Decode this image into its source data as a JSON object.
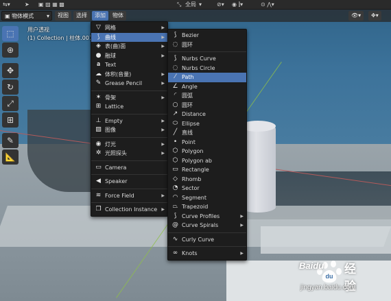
{
  "topbar": {
    "global_label": "全局"
  },
  "header": {
    "mode": "物体模式",
    "menus": [
      "视图",
      "选择",
      "添加",
      "物体"
    ]
  },
  "viewport_info": {
    "line1": "用户透视",
    "line2": "(1) Collection | 柱体.001"
  },
  "add_menu": {
    "items": [
      {
        "label": "网格",
        "icon": "mesh-icon",
        "submenu": true
      },
      {
        "label": "曲线",
        "icon": "curve-icon",
        "submenu": true,
        "highlight": true
      },
      {
        "label": "表(曲)面",
        "icon": "surface-icon",
        "submenu": true
      },
      {
        "label": "融球",
        "icon": "metaball-icon",
        "submenu": true
      },
      {
        "label": "Text",
        "icon": "text-icon",
        "submenu": false
      },
      {
        "label": "体积(音量)",
        "icon": "volume-icon",
        "submenu": true
      },
      {
        "label": "Grease Pencil",
        "icon": "grease-pencil-icon",
        "submenu": true
      },
      {
        "sep": true
      },
      {
        "label": "骨架",
        "icon": "armature-icon",
        "submenu": true
      },
      {
        "label": "Lattice",
        "icon": "lattice-icon",
        "submenu": false
      },
      {
        "sep": true
      },
      {
        "label": "Empty",
        "icon": "empty-icon",
        "submenu": true
      },
      {
        "label": "图像",
        "icon": "image-icon",
        "submenu": true
      },
      {
        "sep": true
      },
      {
        "label": "灯光",
        "icon": "light-icon",
        "submenu": true
      },
      {
        "label": "光照探头",
        "icon": "light-probe-icon",
        "submenu": true
      },
      {
        "sep": true
      },
      {
        "label": "Camera",
        "icon": "camera-icon",
        "submenu": false
      },
      {
        "sep": true
      },
      {
        "label": "Speaker",
        "icon": "speaker-icon",
        "submenu": false
      },
      {
        "sep": true
      },
      {
        "label": "Force Field",
        "icon": "force-field-icon",
        "submenu": true
      },
      {
        "sep": true
      },
      {
        "label": "Collection Instance",
        "icon": "collection-instance-icon",
        "submenu": true
      }
    ]
  },
  "curve_menu": {
    "items": [
      {
        "label": "Bezier",
        "icon": "bezier-icon"
      },
      {
        "label": "圆环",
        "icon": "circle-curve-icon"
      },
      {
        "sep": true
      },
      {
        "label": "Nurbs Curve",
        "icon": "nurbs-curve-icon"
      },
      {
        "label": "Nurbs Circle",
        "icon": "nurbs-circle-icon"
      },
      {
        "label": "Path",
        "icon": "path-icon",
        "highlight": true
      },
      {
        "label": "Angle",
        "icon": "angle-icon"
      },
      {
        "label": "圆弧",
        "icon": "arc-icon"
      },
      {
        "label": "圆环",
        "icon": "circle-icon"
      },
      {
        "label": "Distance",
        "icon": "distance-icon"
      },
      {
        "label": "Ellipse",
        "icon": "ellipse-icon"
      },
      {
        "label": "直线",
        "icon": "line-icon"
      },
      {
        "label": "Point",
        "icon": "point-icon"
      },
      {
        "label": "Polygon",
        "icon": "polygon-icon"
      },
      {
        "label": "Polygon ab",
        "icon": "polygon-ab-icon"
      },
      {
        "label": "Rectangle",
        "icon": "rectangle-icon"
      },
      {
        "label": "Rhomb",
        "icon": "rhomb-icon"
      },
      {
        "label": "Sector",
        "icon": "sector-icon"
      },
      {
        "label": "Segment",
        "icon": "segment-icon"
      },
      {
        "label": "Trapezoid",
        "icon": "trapezoid-icon"
      },
      {
        "label": "Curve Profiles",
        "icon": "curve-profiles-icon",
        "submenu": true
      },
      {
        "label": "Curve Spirals",
        "icon": "curve-spirals-icon",
        "submenu": true
      },
      {
        "sep": true
      },
      {
        "label": "Curly Curve",
        "icon": "curly-curve-icon"
      },
      {
        "sep": true
      },
      {
        "label": "Knots",
        "icon": "knots-icon",
        "submenu": true
      }
    ]
  },
  "watermark": {
    "brand": "Baidu",
    "cn": "经验",
    "url": "jingyan.baidu.com"
  },
  "colors": {
    "highlight": "#4a74b3",
    "menu_bg": "#1d1d1d"
  }
}
